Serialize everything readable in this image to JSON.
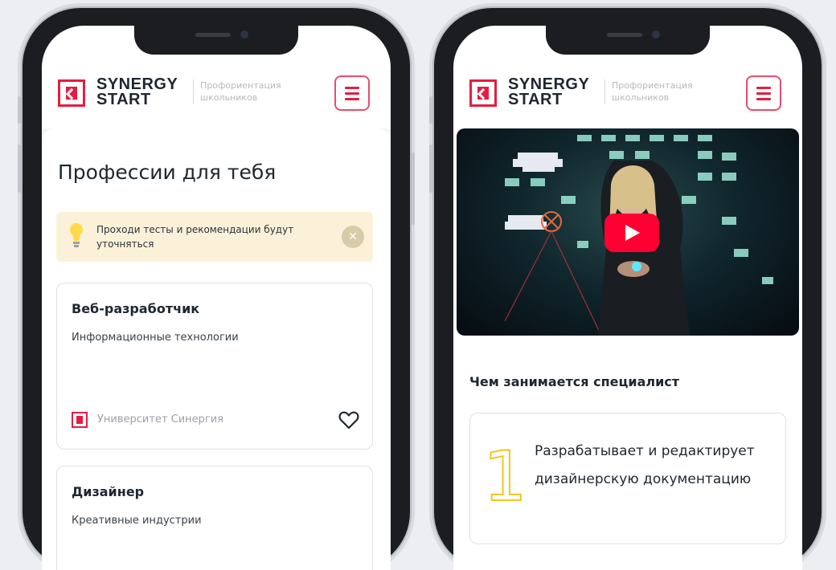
{
  "brand": {
    "line1": "SYNERGY",
    "line2": "START",
    "subtitle": "Профориентация школьников",
    "accent": "#e41d40"
  },
  "left_screen": {
    "page_title": "Профессии для тебя",
    "tip": {
      "text": "Проходи тесты и рекомендации будут уточняться",
      "close_symbol": "✕",
      "icon": "lightbulb-icon",
      "background": "#fbf1d9"
    },
    "professions": [
      {
        "title": "Веб-разработчик",
        "category": "Информационные технологии",
        "university": "Университет Синергия",
        "favorite_icon": "heart-icon"
      },
      {
        "title": "Дизайнер",
        "category": "Креативные индустрии"
      }
    ]
  },
  "right_screen": {
    "video": {
      "play_icon": "play-icon",
      "play_color": "#ff0033"
    },
    "section_title": "Чем занимается специалист",
    "step": {
      "number": "1",
      "text": "Разрабатывает и редактирует дизайнерскую документацию",
      "number_color": "#f1c61c"
    }
  }
}
